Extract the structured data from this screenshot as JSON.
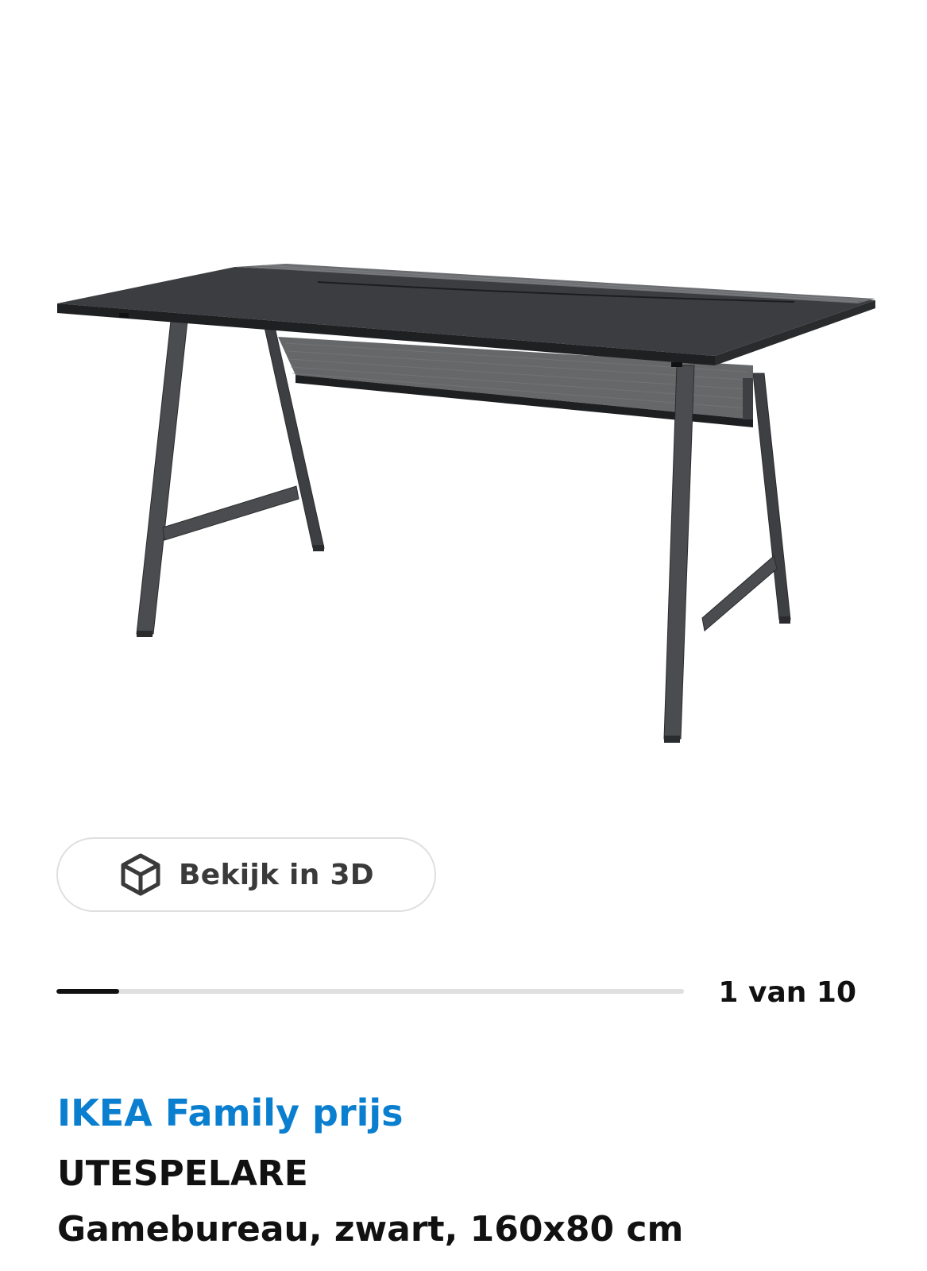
{
  "gallery": {
    "view_3d_label": "Bekijk in 3D",
    "view_3d_icon": "cube-icon",
    "counter": "1 van 10",
    "current_image": 1,
    "total_images": 10,
    "progress_fraction": 0.1
  },
  "product": {
    "price_label": "IKEA Family prijs",
    "name": "UTESPELARE",
    "description": "Gamebureau, zwart, 160x80 cm"
  },
  "colors": {
    "price_accent": "#0a7fcf",
    "text": "#111111",
    "track": "#dfdfdf",
    "track_fill": "#111111"
  }
}
